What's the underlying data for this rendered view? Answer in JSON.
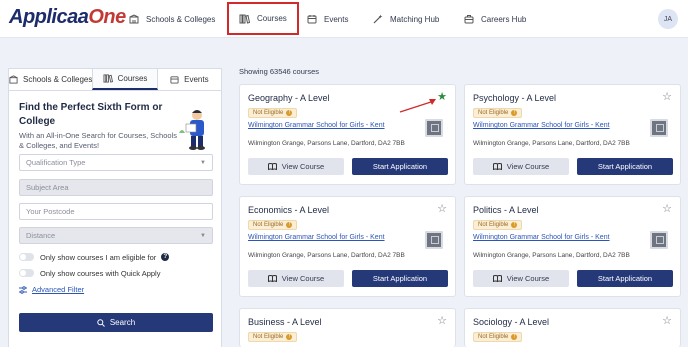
{
  "nav": {
    "logo_main": "Applicaa",
    "logo_accent": "One",
    "items": [
      {
        "label": "Schools & Colleges",
        "icon": "building-icon"
      },
      {
        "label": "Courses",
        "icon": "books-icon",
        "highlighted": true
      },
      {
        "label": "Events",
        "icon": "calendar-icon"
      },
      {
        "label": "Matching Hub",
        "icon": "magic-wand-icon"
      },
      {
        "label": "Careers Hub",
        "icon": "briefcase-icon"
      }
    ],
    "avatar_initials": "JA"
  },
  "left_panel": {
    "tabs": [
      {
        "label": "Schools & Colleges",
        "icon": "building-icon"
      },
      {
        "label": "Courses",
        "icon": "books-icon",
        "active": true
      },
      {
        "label": "Events",
        "icon": "calendar-icon"
      }
    ],
    "title": "Find the Perfect Sixth Form or College",
    "description": "With an All-in-One Search for Courses, Schools & Colleges, and Events!",
    "fields": {
      "qualification_type": {
        "placeholder": "Qualification Type"
      },
      "subject_area": {
        "placeholder": "Subject Area"
      },
      "postcode": {
        "placeholder": "Your Postcode"
      },
      "distance": {
        "placeholder": "Distance"
      }
    },
    "toggles": {
      "eligible": {
        "label": "Only show courses I am eligible for",
        "on": false
      },
      "quick_apply": {
        "label": "Only show courses with Quick Apply",
        "on": false
      }
    },
    "advanced_filter": "Advanced Filter",
    "search_button": "Search"
  },
  "results": {
    "showing": "Showing 63546 courses",
    "cards": [
      {
        "title": "Geography - A Level",
        "badge": "Not Eligible",
        "school": "Wilmington Grammar School for Girls - Kent",
        "address": "Wilmington Grange, Parsons Lane, Dartford, DA2 7BB",
        "view": "View Course",
        "apply": "Start Application",
        "favourited": true
      },
      {
        "title": "Psychology - A Level",
        "badge": "Not Eligible",
        "school": "Wilmington Grammar School for Girls - Kent",
        "address": "Wilmington Grange, Parsons Lane, Dartford, DA2 7BB",
        "view": "View Course",
        "apply": "Start Application",
        "favourited": false
      },
      {
        "title": "Economics - A Level",
        "badge": "Not Eligible",
        "school": "Wilmington Grammar School for Girls - Kent",
        "address": "Wilmington Grange, Parsons Lane, Dartford, DA2 7BB",
        "view": "View Course",
        "apply": "Start Application",
        "favourited": false
      },
      {
        "title": "Politics - A Level",
        "badge": "Not Eligible",
        "school": "Wilmington Grammar School for Girls - Kent",
        "address": "Wilmington Grange, Parsons Lane, Dartford, DA2 7BB",
        "view": "View Course",
        "apply": "Start Application",
        "favourited": false
      },
      {
        "title": "Business - A Level",
        "badge": "Not Eligible"
      },
      {
        "title": "Sociology - A Level",
        "badge": "Not Eligible"
      }
    ]
  },
  "colors": {
    "brand_navy": "#253878",
    "brand_red": "#c23a36",
    "favourite_green": "#2e8b3a",
    "highlight_red": "#d12a2a",
    "link_blue": "#2d55b8"
  }
}
